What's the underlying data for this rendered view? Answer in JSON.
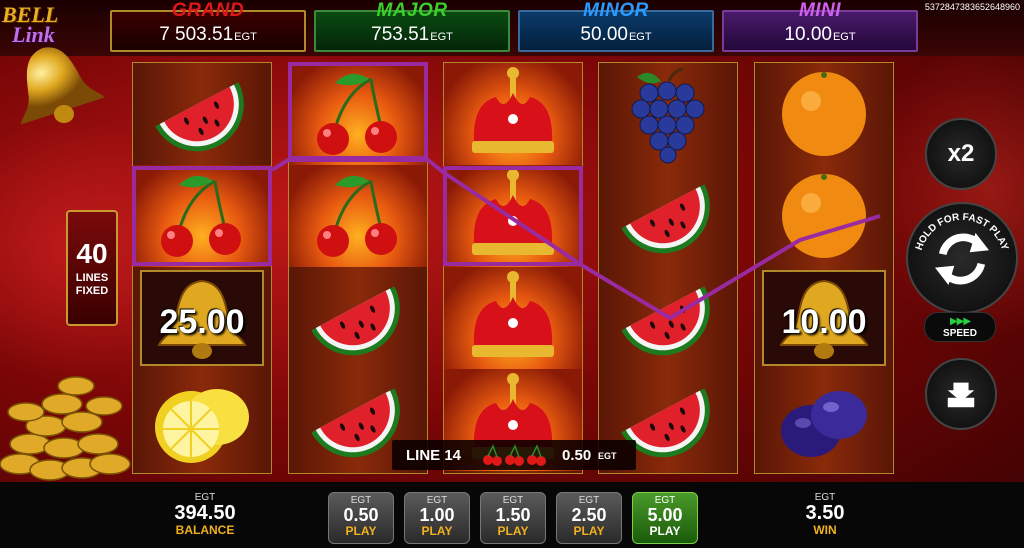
{
  "game_id": "5372847383652648960",
  "logo": {
    "line1": "BELL",
    "line2": "Link"
  },
  "jackpots": [
    {
      "title": "GRAND",
      "value": "7 503.51",
      "unit": "EGT",
      "color": "#e01818"
    },
    {
      "title": "MAJOR",
      "value": "753.51",
      "unit": "EGT",
      "color": "#3ad02a"
    },
    {
      "title": "MINOR",
      "value": "50.00",
      "unit": "EGT",
      "color": "#2a9aff"
    },
    {
      "title": "MINI",
      "value": "10.00",
      "unit": "EGT",
      "color": "#d060f0"
    }
  ],
  "lines": {
    "count": "40",
    "label": "LINES FIXED"
  },
  "reels": [
    [
      "watermelon",
      "cherries",
      "bell-25",
      "lemon"
    ],
    [
      "cherries",
      "cherries",
      "watermelon",
      "watermelon"
    ],
    [
      "crown",
      "crown",
      "crown",
      "crown"
    ],
    [
      "grapes",
      "watermelon",
      "watermelon",
      "watermelon"
    ],
    [
      "orange",
      "orange",
      "bell-10",
      "plum"
    ]
  ],
  "bell_values": {
    "bell-25": "25.00",
    "bell-10": "10.00"
  },
  "controls": {
    "multiplier_label": "x2",
    "spin_label": "HOLD FOR FAST PLAY",
    "speed_label": "SPEED",
    "speed_arrows": "▶▶▶"
  },
  "line_win": {
    "label": "LINE 14",
    "amount": "0.50",
    "unit": "EGT",
    "symbol": "cherries"
  },
  "balance": {
    "currency": "EGT",
    "value": "394.50",
    "label": "BALANCE"
  },
  "win": {
    "currency": "EGT",
    "value": "3.50",
    "label": "WIN"
  },
  "bets": [
    {
      "currency": "EGT",
      "value": "0.50",
      "label": "PLAY",
      "active": false
    },
    {
      "currency": "EGT",
      "value": "1.00",
      "label": "PLAY",
      "active": false
    },
    {
      "currency": "EGT",
      "value": "1.50",
      "label": "PLAY",
      "active": false
    },
    {
      "currency": "EGT",
      "value": "2.50",
      "label": "PLAY",
      "active": false
    },
    {
      "currency": "EGT",
      "value": "5.00",
      "label": "PLAY",
      "active": true
    }
  ],
  "colors": {
    "win_line": "#9a2aa0",
    "gold": "#c89a30",
    "play_label": "#f0b020"
  }
}
